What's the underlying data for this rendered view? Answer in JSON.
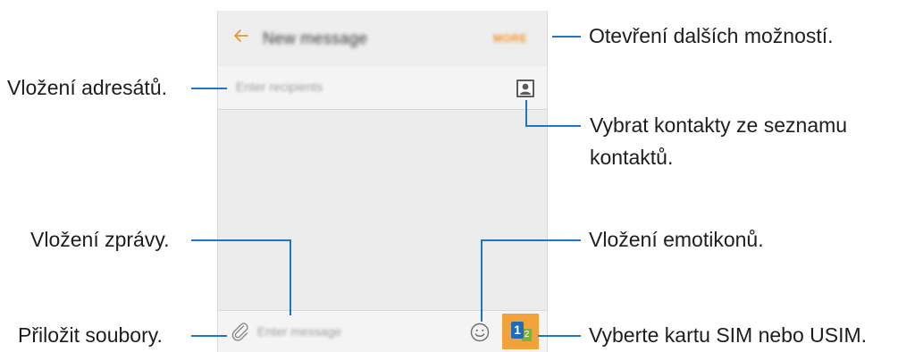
{
  "app": {
    "title": "New message",
    "more_label": "MORE",
    "recipients_placeholder": "Enter recipients",
    "message_placeholder": "Enter message",
    "sim_primary": "1",
    "sim_secondary": "2"
  },
  "icons": {
    "back": "back-arrow-icon",
    "contacts": "contact-card-icon",
    "attach": "paperclip-icon",
    "emoji": "smiley-icon",
    "sim": "sim-card-icon"
  },
  "colors": {
    "accent": "#f2932b",
    "callout": "#1e77c6",
    "sim_button": "#f2a23a",
    "sim_one": "#1e6bb8",
    "sim_two": "#7fae3a"
  },
  "callouts": {
    "more_options": "Otevření dalších možností.",
    "add_recipients": "Vložení adresátů.",
    "select_contacts_line1": "Vybrat kontakty ze seznamu",
    "select_contacts_line2": "kontaktů.",
    "insert_message": "Vložení zprávy.",
    "insert_emoticons": "Vložení emotikonů.",
    "attach_files": "Přiložit soubory.",
    "choose_sim": "Vyberte kartu SIM nebo USIM."
  }
}
